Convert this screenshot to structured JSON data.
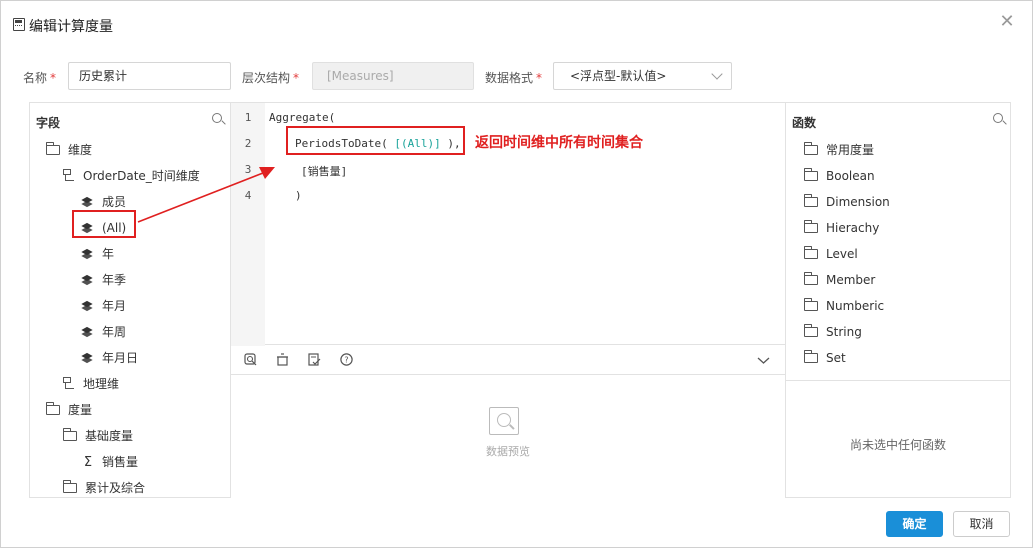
{
  "dialog": {
    "title": "编辑计算度量",
    "close_glyph": "✕"
  },
  "form": {
    "name_label": "名称",
    "name_value": "历史累计",
    "hierarchy_label": "层次结构",
    "hierarchy_value": "[Measures]",
    "format_label": "数据格式",
    "format_value": "<浮点型-默认值>",
    "required_mark": "*"
  },
  "fields_panel": {
    "header": "字段",
    "items": [
      {
        "label": "维度",
        "icon": "folder-icon"
      },
      {
        "label": "OrderDate_时间维度",
        "icon": "hierarchy-icon"
      },
      {
        "label": "成员",
        "icon": "layers-icon"
      },
      {
        "label": "(All)",
        "icon": "layers-icon"
      },
      {
        "label": "年",
        "icon": "layers-icon"
      },
      {
        "label": "年季",
        "icon": "layers-icon"
      },
      {
        "label": "年月",
        "icon": "layers-icon"
      },
      {
        "label": "年周",
        "icon": "layers-icon"
      },
      {
        "label": "年月日",
        "icon": "layers-icon"
      },
      {
        "label": "地理维",
        "icon": "hierarchy-icon"
      },
      {
        "label": "度量",
        "icon": "folder-icon"
      },
      {
        "label": "基础度量",
        "icon": "folder-icon"
      },
      {
        "label": "销售量",
        "icon": "sigma-icon"
      },
      {
        "label": "累计及综合",
        "icon": "folder-icon"
      }
    ]
  },
  "editor": {
    "line_numbers": [
      "1",
      "2",
      "3",
      "4"
    ],
    "line1": "Aggregate(",
    "line2_func": "PeriodsToDate( ",
    "line2_arg": "[(All)]",
    "line2_end": " ),",
    "line3": "[销售量]",
    "line4": ")",
    "annotation": "返回时间维中所有时间集合",
    "accent_color": "#1aa39a",
    "annotation_color": "#e02020"
  },
  "preview": {
    "label": "数据预览"
  },
  "functions_panel": {
    "header": "函数",
    "items": [
      "常用度量",
      "Boolean",
      "Dimension",
      "Hierachy",
      "Level",
      "Member",
      "Numberic",
      "String",
      "Set"
    ],
    "empty_text": "尚未选中任何函数"
  },
  "footer": {
    "ok_label": "确定",
    "cancel_label": "取消",
    "primary_color": "#1a8fd8"
  }
}
